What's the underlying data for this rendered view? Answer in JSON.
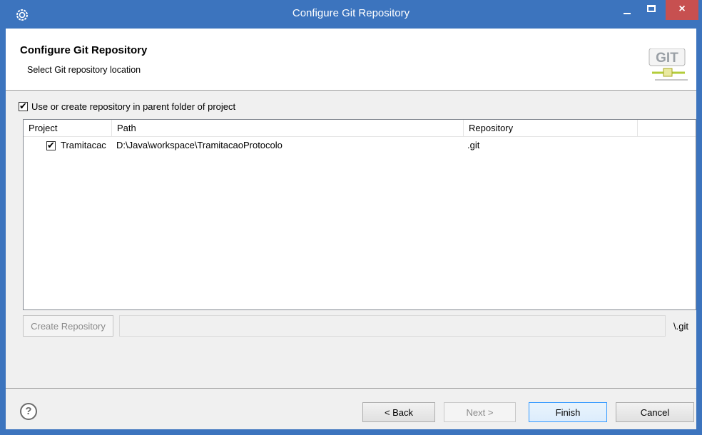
{
  "window": {
    "title": "Configure Git Repository",
    "icons": {
      "app": "eclipse-gear-icon",
      "minimize": "minimize-icon",
      "maximize": "maximize-icon",
      "close": "close-icon"
    },
    "close_glyph": "×"
  },
  "header": {
    "title": "Configure Git Repository",
    "subtitle": "Select Git repository location",
    "logo_text": "GIT"
  },
  "options": {
    "use_parent_folder_label": "Use or create repository in parent folder of project",
    "use_parent_folder_checked": true
  },
  "table": {
    "columns": [
      "Project",
      "Path",
      "Repository",
      ""
    ],
    "rows": [
      {
        "checked": true,
        "project": "Tramitacac",
        "path": "D:\\Java\\workspace\\TramitacaoProtocolo",
        "repository": ".git"
      }
    ]
  },
  "create_repo": {
    "button_label": "Create Repository",
    "path_value": "",
    "suffix": "\\.git"
  },
  "footer": {
    "help_glyph": "?",
    "back_label": "< Back",
    "next_label": "Next >",
    "finish_label": "Finish",
    "cancel_label": "Cancel"
  },
  "colors": {
    "titlebar": "#3c74be",
    "close_button": "#c75050",
    "default_button_border": "#3399ff"
  }
}
